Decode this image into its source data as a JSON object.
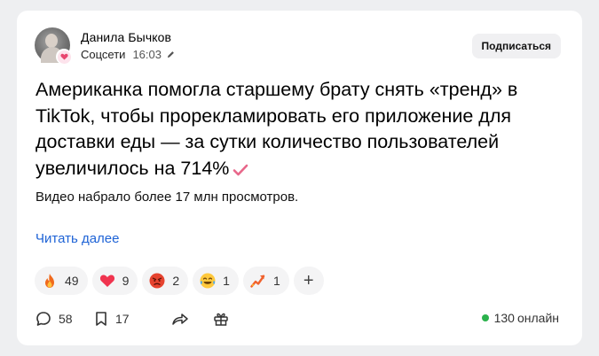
{
  "post": {
    "author": "Данила Бычков",
    "community": "Соцсети",
    "time": "16:03",
    "subscribe_label": "Подписаться",
    "title": "Американка помогла старшему брату снять «тренд» в TikTok, чтобы прорекламировать его приложение для доставки еды — за сутки количество пользователей увеличилось на 714%",
    "subtitle": "Видео набрало более 17 млн просмотров.",
    "read_more": "Читать далее"
  },
  "reactions": [
    {
      "icon": "fire-icon",
      "count": "49"
    },
    {
      "icon": "heart-icon",
      "count": "9"
    },
    {
      "icon": "angry-face-icon",
      "count": "2"
    },
    {
      "icon": "laughing-crying-face-icon",
      "count": "1"
    },
    {
      "icon": "chart-rising-icon",
      "count": "1"
    }
  ],
  "add_reaction_label": "+",
  "footer": {
    "comments": "58",
    "bookmarks": "17",
    "online_count": "130",
    "online_label": "онлайн"
  },
  "colors": {
    "accent_link": "#1e63d6",
    "online_dot": "#2bb24c",
    "check": "#e8678a"
  }
}
